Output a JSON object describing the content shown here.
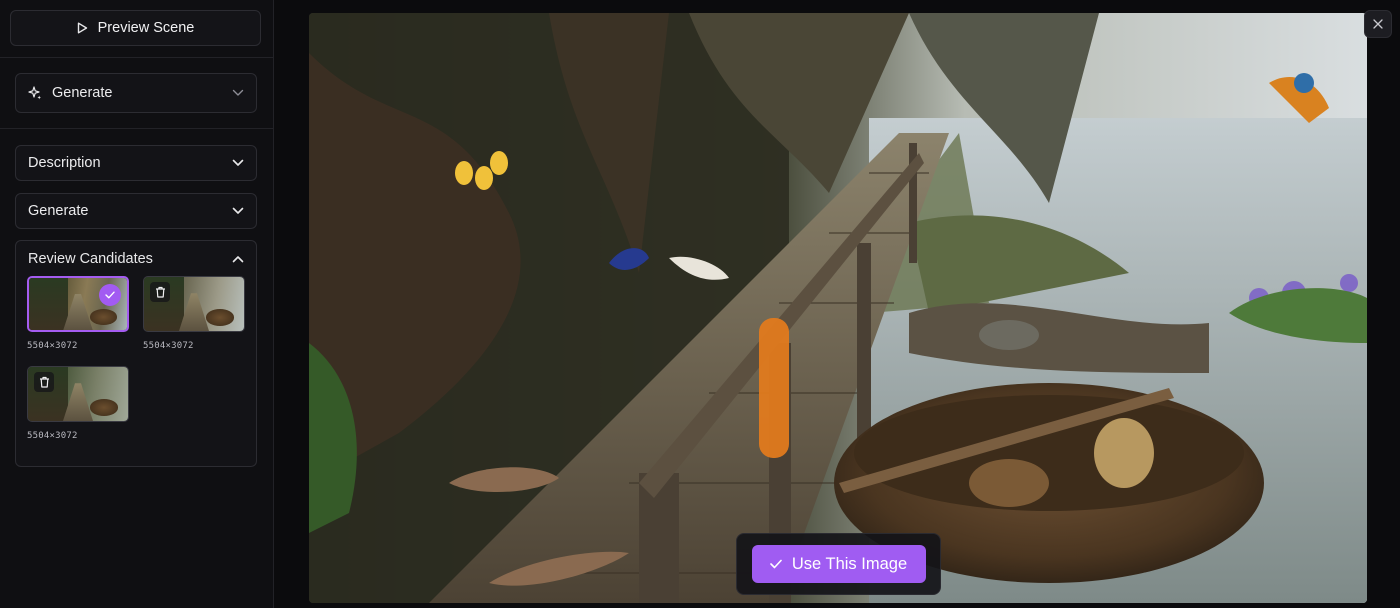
{
  "sidebar": {
    "preview_label": "Preview Scene",
    "generate_dropdown_label": "Generate",
    "description_label": "Description",
    "generate_section_label": "Generate",
    "review_label": "Review Candidates",
    "candidates": [
      {
        "dims": "5504×3072",
        "selected": true
      },
      {
        "dims": "5504×3072",
        "selected": false
      },
      {
        "dims": "5504×3072",
        "selected": false
      }
    ]
  },
  "main": {
    "use_button_label": "Use This Image"
  },
  "colors": {
    "accent": "#a05cf2",
    "background": "#0b0b0d",
    "panel": "#131317"
  },
  "icons": [
    "play-icon",
    "sparkle-icon",
    "chevron-down-icon",
    "chevron-up-icon",
    "check-icon",
    "trash-icon",
    "close-icon"
  ]
}
